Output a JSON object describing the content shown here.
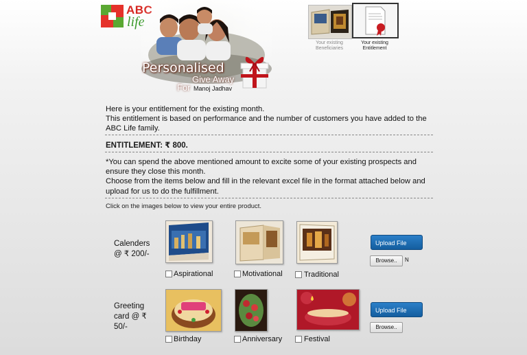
{
  "brand": {
    "logo_abc": "ABC",
    "logo_life": "life"
  },
  "header": {
    "title_line1": "Personalised",
    "title_line2": "Give Away",
    "for_label": "For",
    "recipient_name": "Manoj Jadhav"
  },
  "top_nav": [
    {
      "caption": "Your existing Beneficiaries",
      "icon": "calendar-photo-icon"
    },
    {
      "caption": "Your existing Entitlement",
      "icon": "certificate-icon"
    }
  ],
  "intro": {
    "line1": "Here is your entitlement for the existing month.",
    "line2": "This entitlement is based on performance and the number of customers you have added to the ABC Life family."
  },
  "entitlement": {
    "label": "ENTITLEMENT: ₹ 800."
  },
  "instructions": {
    "line1": "*You can spend the above mentioned amount to excite some of your existing prospects and ensure they close this month.",
    "line2": "Choose from the items below and fill in the relevant excel file in the format attached below and upload for us to do the fulfillment."
  },
  "hint": "Click on the images below to view your entire product.",
  "rows": [
    {
      "label": "Calenders @ ₹ 200/-",
      "items": [
        "Aspirational",
        "Motivational",
        "Traditional"
      ],
      "upload_label": "Upload File",
      "browse_label": "Browse..",
      "file_status": "N"
    },
    {
      "label": "Greeting card @ ₹ 50/-",
      "items": [
        "Birthday",
        "Anniversary",
        "Festival"
      ],
      "upload_label": "Upload File",
      "browse_label": "Browse..",
      "file_status": ""
    }
  ],
  "colors": {
    "brand_red": "#d6251f",
    "brand_green": "#3a9a2a",
    "upload_blue": "#1a6db5"
  }
}
